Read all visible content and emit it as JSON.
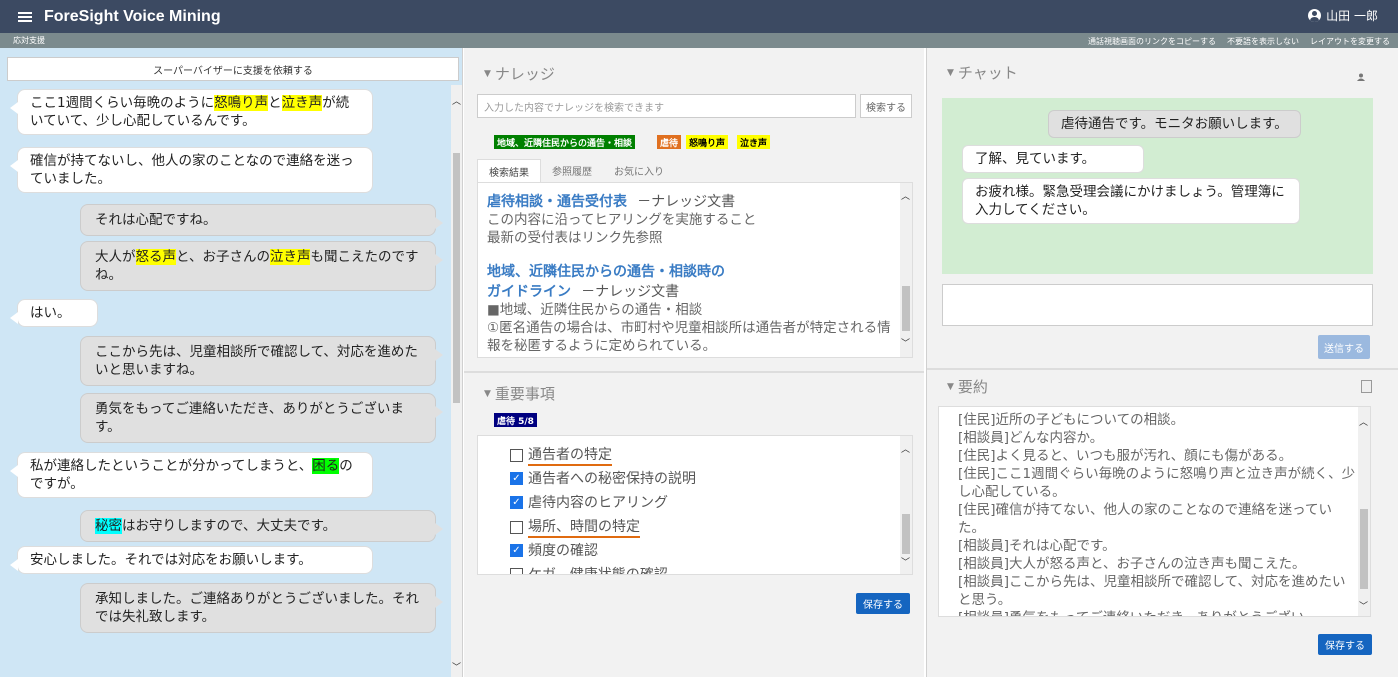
{
  "header": {
    "app_title": "ForeSight Voice Mining",
    "user_name": "山田 一郎"
  },
  "subbar": {
    "section": "応対支援",
    "links": [
      "通話視聴画面のリンクをコピーする",
      "不要語を表示しない",
      "レイアウトを変更する"
    ]
  },
  "left": {
    "support_button": "スーパーバイザーに支援を依頼する",
    "messages": [
      {
        "role": "customer",
        "parts": [
          [
            "ここ1週間くらい毎晩のように",
            ""
          ],
          [
            "怒鳴り声",
            "y"
          ],
          [
            "と",
            ""
          ],
          [
            "泣き声",
            "y"
          ],
          [
            "が続いていて、少し心配しているんです。",
            ""
          ]
        ]
      },
      {
        "role": "customer",
        "parts": [
          [
            "確信が持てないし、他人の家のことなので連絡を迷っていました。",
            ""
          ]
        ]
      },
      {
        "role": "agent",
        "parts": [
          [
            "それは心配ですね。",
            ""
          ]
        ]
      },
      {
        "role": "agent",
        "parts": [
          [
            "大人が",
            ""
          ],
          [
            "怒る声",
            "y"
          ],
          [
            "と、お子さんの",
            ""
          ],
          [
            "泣き声",
            "y"
          ],
          [
            "も聞こえたのですね。",
            ""
          ]
        ]
      },
      {
        "role": "customer",
        "parts": [
          [
            "はい。",
            ""
          ]
        ]
      },
      {
        "role": "agent",
        "parts": [
          [
            "ここから先は、児童相談所で確認して、対応を進めたいと思いますね。",
            ""
          ]
        ]
      },
      {
        "role": "agent",
        "parts": [
          [
            "勇気をもってご連絡いただき、ありがとうございます。",
            ""
          ]
        ]
      },
      {
        "role": "customer",
        "parts": [
          [
            "私が連絡したということが分かってしまうと、",
            ""
          ],
          [
            "困",
            "g"
          ],
          [
            "る",
            "g"
          ],
          [
            "のですが。",
            ""
          ]
        ]
      },
      {
        "role": "agent",
        "parts": [
          [
            "秘密",
            "c"
          ],
          [
            "はお守りしますので、大丈夫です。",
            ""
          ]
        ]
      },
      {
        "role": "customer",
        "parts": [
          [
            "安心しました。それでは対応をお願いします。",
            ""
          ]
        ]
      },
      {
        "role": "agent",
        "parts": [
          [
            "承知しました。ご連絡ありがとうございました。それでは失礼致します。",
            ""
          ]
        ]
      }
    ]
  },
  "knowledge": {
    "title": "ナレッジ",
    "search_placeholder": "入力した内容でナレッジを検索できます",
    "search_button": "検索する",
    "tags": [
      {
        "label": "地域、近隣住民からの通告・相談",
        "bg": "#008000",
        "fg": "#ffffff"
      },
      {
        "label": "虐待",
        "bg": "#e07020",
        "fg": "#ffffff"
      },
      {
        "label": "怒鳴り声",
        "bg": "#ffff00",
        "fg": "#000000"
      },
      {
        "label": "泣き声",
        "bg": "#ffff00",
        "fg": "#000000"
      }
    ],
    "tabs": [
      "検索結果",
      "参照履歴",
      "お気に入り"
    ],
    "results": [
      {
        "title": "虐待相談・通告受付表",
        "type": "－ナレッジ文書",
        "body": "この内容に沿ってヒアリングを実施すること\n最新の受付表はリンク先参照"
      },
      {
        "title_line1": "地域、近隣住民からの通告・相談時の",
        "title_line2": "ガイドライン",
        "type": "－ナレッジ文書",
        "body": "■地域、近隣住民からの通告・相談\n①匿名通告の場合は、市町村や児童相談所は通告者が特定される情報を秘匿するように定められている。"
      }
    ]
  },
  "important": {
    "title": "重要事項",
    "badge": "虐待 5/8",
    "items": [
      {
        "label": "通告者の特定",
        "checked": false,
        "alert": true
      },
      {
        "label": "通告者への秘密保持の説明",
        "checked": true,
        "alert": false
      },
      {
        "label": "虐待内容のヒアリング",
        "checked": true,
        "alert": false
      },
      {
        "label": "場所、時間の特定",
        "checked": false,
        "alert": true
      },
      {
        "label": "頻度の確認",
        "checked": true,
        "alert": false
      },
      {
        "label": "ケガ、健康状態の確認",
        "checked": false,
        "alert": false
      }
    ],
    "save_button": "保存する"
  },
  "chat": {
    "title": "チャット",
    "messages": [
      {
        "role": "operator",
        "text": "虐待通告です。モニタお願いします。"
      },
      {
        "role": "supervisor",
        "text": "了解、見ています。"
      },
      {
        "role": "supervisor",
        "text": "お疲れ様。緊急受理会議にかけましょう。管理簿に入力してください。"
      }
    ],
    "send_button": "送信する"
  },
  "summary": {
    "title": "要約",
    "lines": [
      "[住民]近所の子どもについての相談。",
      "[相談員]どんな内容か。",
      "[住民]よく見ると、いつも服が汚れ、顔にも傷がある。",
      "[住民]ここ1週間ぐらい毎晩のように怒鳴り声と泣き声が続く、少し心配している。",
      "[住民]確信が持てない、他人の家のことなので連絡を迷っていた。",
      "[相談員]それは心配です。",
      "[相談員]大人が怒る声と、お子さんの泣き声も聞こえた。",
      "[相談員]ここから先は、児童相談所で確認して、対応を進めたいと思う。",
      "[相談員]勇気をもってご連絡いただき、ありがとうござい"
    ],
    "save_button": "保存する"
  }
}
